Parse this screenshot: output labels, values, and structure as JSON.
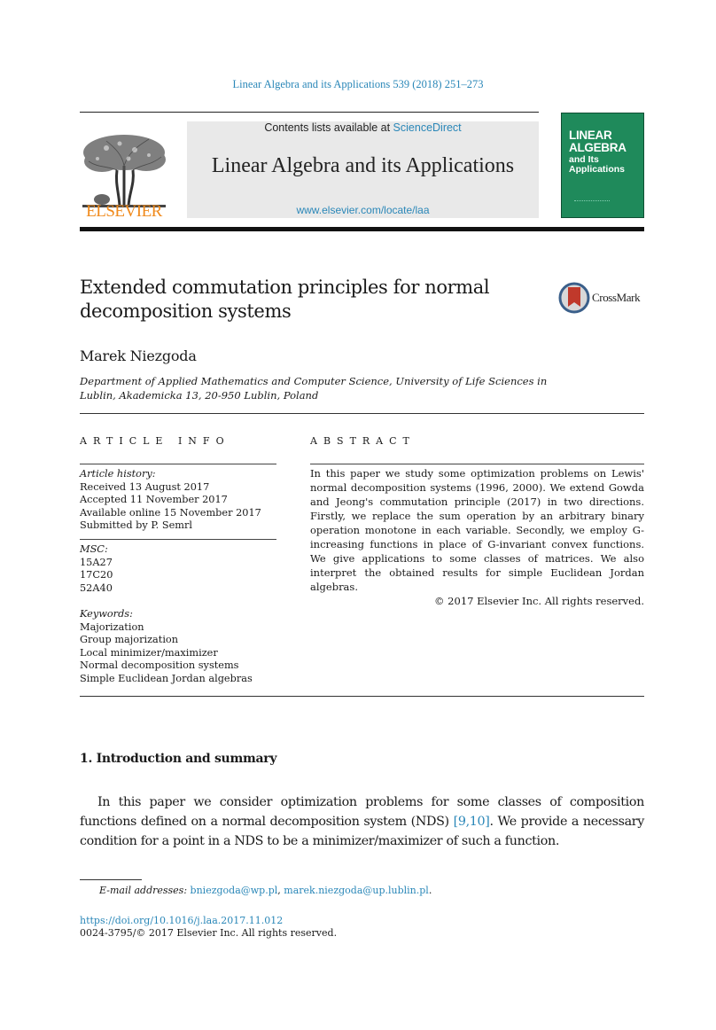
{
  "header": {
    "journal_ref": "Linear Algebra and its Applications 539 (2018) 251–273",
    "contents_prefix": "Contents lists available at ",
    "contents_link": "ScienceDirect",
    "journal_title": "Linear Algebra and its Applications",
    "journal_url": "www.elsevier.com/locate/laa",
    "publisher_logo": "ELSEVIER",
    "cover": {
      "line1": "LINEAR",
      "line2": "ALGEBRA",
      "line3": "and Its",
      "line4": "Applications",
      "color": "#1f8a5b"
    }
  },
  "article": {
    "title": "Extended commutation principles for normal decomposition systems",
    "crossmark_label": "CrossMark",
    "author": "Marek Niezgoda",
    "affiliation": "Department of Applied Mathematics and Computer Science, University of Life Sciences in Lublin, Akademicka 13, 20-950 Lublin, Poland"
  },
  "article_info": {
    "caption": "ARTICLE INFO",
    "history_label": "Article history:",
    "history": [
      "Received 13 August 2017",
      "Accepted 11 November 2017",
      "Available online 15 November 2017",
      "Submitted by P. Semrl"
    ],
    "msc_label": "MSC:",
    "msc": [
      "15A27",
      "17C20",
      "52A40"
    ],
    "keywords_label": "Keywords:",
    "keywords": [
      "Majorization",
      "Group majorization",
      "Local minimizer/maximizer",
      "Normal decomposition systems",
      "Simple Euclidean Jordan algebras"
    ]
  },
  "abstract": {
    "caption": "ABSTRACT",
    "text": "In this paper we study some optimization problems on Lewis' normal decomposition systems (1996, 2000). We extend Gowda and Jeong's commutation principle (2017) in two directions. Firstly, we replace the sum operation by an arbitrary binary operation monotone in each variable. Secondly, we employ G-increasing functions in place of G-invariant convex functions. We give applications to some classes of matrices. We also interpret the obtained results for simple Euclidean Jordan algebras.",
    "copyright": "© 2017 Elsevier Inc. All rights reserved."
  },
  "intro": {
    "section_title": "1.  Introduction and summary",
    "text_before": "In this paper we consider optimization problems for some classes of composition functions defined on a normal decomposition system (NDS) ",
    "citation": "[9,10]",
    "text_after": ". We provide a necessary condition for a point in a NDS to be a minimizer/maximizer of such a function."
  },
  "footer": {
    "email_label": "E-mail addresses:",
    "email1": "bniezgoda@wp.pl",
    "email2": "marek.niezgoda@up.lublin.pl",
    "doi": "https://doi.org/10.1016/j.laa.2017.11.012",
    "issn": "0024-3795/© 2017 Elsevier Inc. All rights reserved."
  },
  "colors": {
    "link": "#2a87b8",
    "elsevier_orange": "#f08a1c",
    "banner_bg": "#e9e9e9"
  }
}
